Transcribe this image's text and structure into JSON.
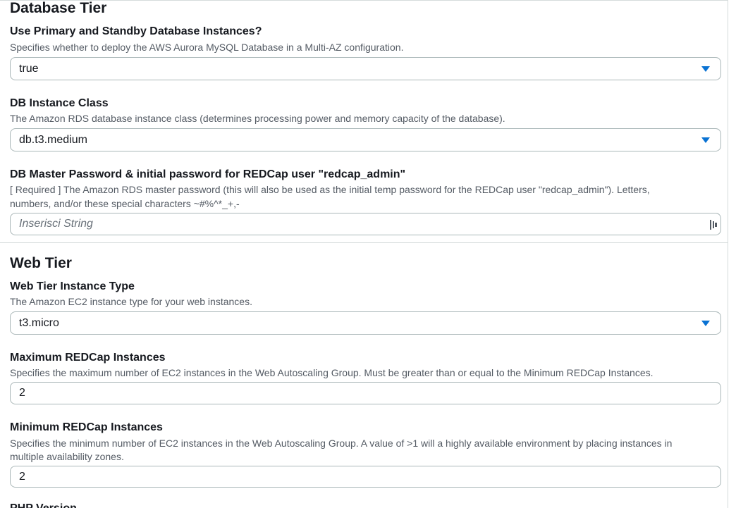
{
  "database_tier": {
    "title": "Database Tier",
    "multi_az": {
      "label": "Use Primary and Standby Database Instances?",
      "description": "Specifies whether to deploy the AWS Aurora MySQL Database in a Multi-AZ configuration.",
      "value": "true"
    },
    "instance_class": {
      "label": "DB Instance Class",
      "description": "The Amazon RDS database instance class (determines processing power and memory capacity of the database).",
      "value": "db.t3.medium"
    },
    "master_password": {
      "label": "DB Master Password & initial password for REDCap user \"redcap_admin\"",
      "description_line1": "[ Required ] The Amazon RDS master password (this will also be used as the initial temp password for the REDCap user \"redcap_admin\"). Letters,",
      "description_line2": "numbers, and/or these special characters ~#%^*_+,-",
      "placeholder": "Inserisci String",
      "icon": "password-manager-icon"
    }
  },
  "web_tier": {
    "title": "Web Tier",
    "instance_type": {
      "label": "Web Tier Instance Type",
      "description": "The Amazon EC2 instance type for your web instances.",
      "value": "t3.micro"
    },
    "max_instances": {
      "label": "Maximum REDCap Instances",
      "description": "Specifies the maximum number of EC2 instances in the Web Autoscaling Group. Must be greater than or equal to the Minimum REDCap Instances.",
      "value": "2"
    },
    "min_instances": {
      "label": "Minimum REDCap Instances",
      "description_line1": "Specifies the minimum number of EC2 instances in the Web Autoscaling Group. A value of >1 will a highly available environment by placing instances in",
      "description_line2": "multiple availability zones.",
      "value": "2"
    },
    "next_label_partial": "PHP Version"
  },
  "colors": {
    "caret": "#0972d3",
    "border": "#aab7b8",
    "description": "#545b64",
    "divider": "#d5dbdb"
  }
}
